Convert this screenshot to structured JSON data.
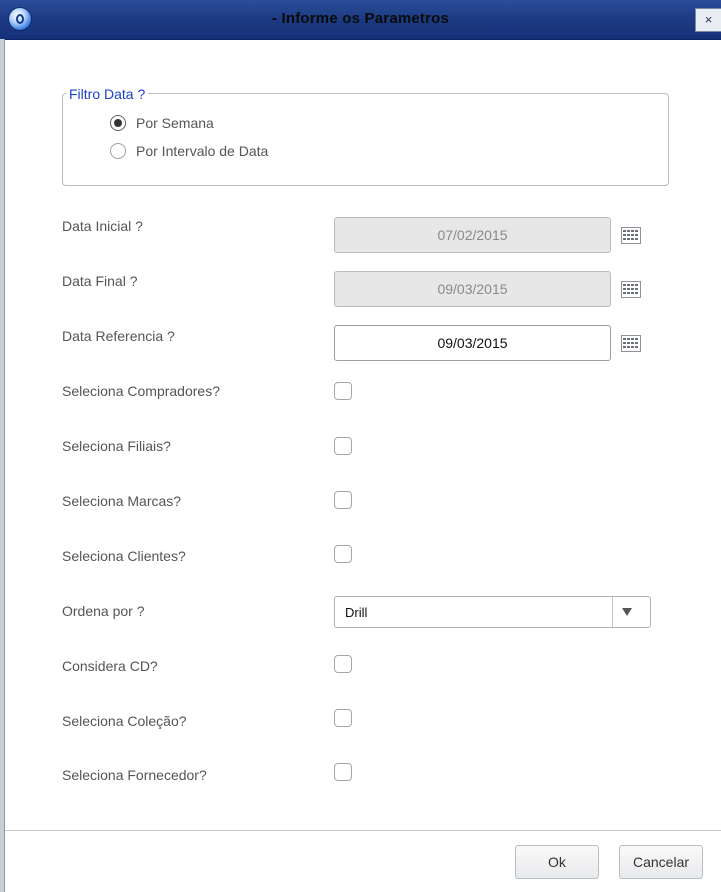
{
  "window": {
    "title": "- Informe os Parametros",
    "close_label": "×"
  },
  "filter_group": {
    "legend": "Filtro Data ?",
    "options": [
      {
        "label": "Por Semana",
        "selected": true
      },
      {
        "label": "Por Intervalo de Data",
        "selected": false
      }
    ]
  },
  "fields": {
    "data_inicial": {
      "label": "Data Inicial ?",
      "value": "07/02/2015",
      "enabled": false
    },
    "data_final": {
      "label": "Data Final ?",
      "value": "09/03/2015",
      "enabled": false
    },
    "data_referencia": {
      "label": "Data Referencia ?",
      "value": "09/03/2015",
      "enabled": true
    }
  },
  "checks": {
    "compradores": {
      "label": "Seleciona Compradores?",
      "checked": false
    },
    "filiais": {
      "label": "Seleciona Filiais?",
      "checked": false
    },
    "marcas": {
      "label": "Seleciona Marcas?",
      "checked": false
    },
    "clientes": {
      "label": "Seleciona Clientes?",
      "checked": false
    },
    "considera_cd": {
      "label": "Considera CD?",
      "checked": false
    },
    "colecao": {
      "label": "Seleciona Coleção?",
      "checked": false
    },
    "fornecedor": {
      "label": "Seleciona Fornecedor?",
      "checked": false
    }
  },
  "ordena": {
    "label": "Ordena por ?",
    "value": "Drill"
  },
  "buttons": {
    "ok": "Ok",
    "cancel": "Cancelar"
  },
  "icons": {
    "app": "app-icon",
    "calendar": "calendar-icon",
    "dropdown": "chevron-down-icon"
  }
}
